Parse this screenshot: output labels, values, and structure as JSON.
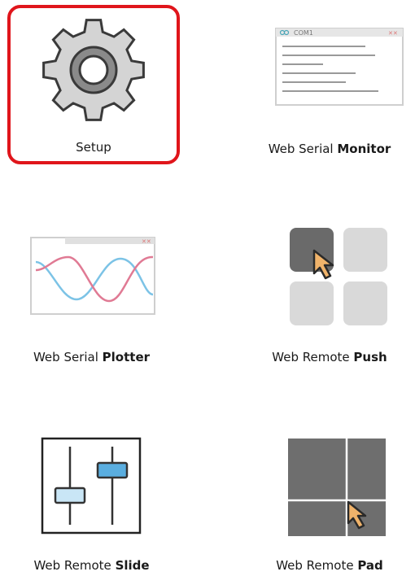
{
  "tiles": [
    {
      "id": "setup",
      "label": "Setup",
      "selected": true
    },
    {
      "id": "monitor",
      "label_plain": "Web Serial ",
      "label_bold": "Monitor",
      "window_title": "COM1"
    },
    {
      "id": "plotter",
      "label_plain": "Web Serial ",
      "label_bold": "Plotter"
    },
    {
      "id": "push",
      "label_plain": "Web Remote ",
      "label_bold": "Push"
    },
    {
      "id": "slide",
      "label_plain": "Web Remote ",
      "label_bold": "Slide"
    },
    {
      "id": "pad",
      "label_plain": "Web Remote ",
      "label_bold": "Pad"
    }
  ],
  "icons": {
    "setup": "gear-icon",
    "monitor": "serial-monitor-window-icon",
    "plotter": "serial-plotter-wave-icon",
    "push": "remote-push-buttons-icon",
    "slide": "remote-sliders-icon",
    "pad": "remote-touchpad-icon"
  },
  "colors": {
    "selection": "#e0151b",
    "gear": "#d4d4d4",
    "wave_pink": "#e07a94",
    "wave_blue": "#7cc3e6",
    "cursor": "#f0b36a",
    "slider_blue": "#5aaee0"
  }
}
